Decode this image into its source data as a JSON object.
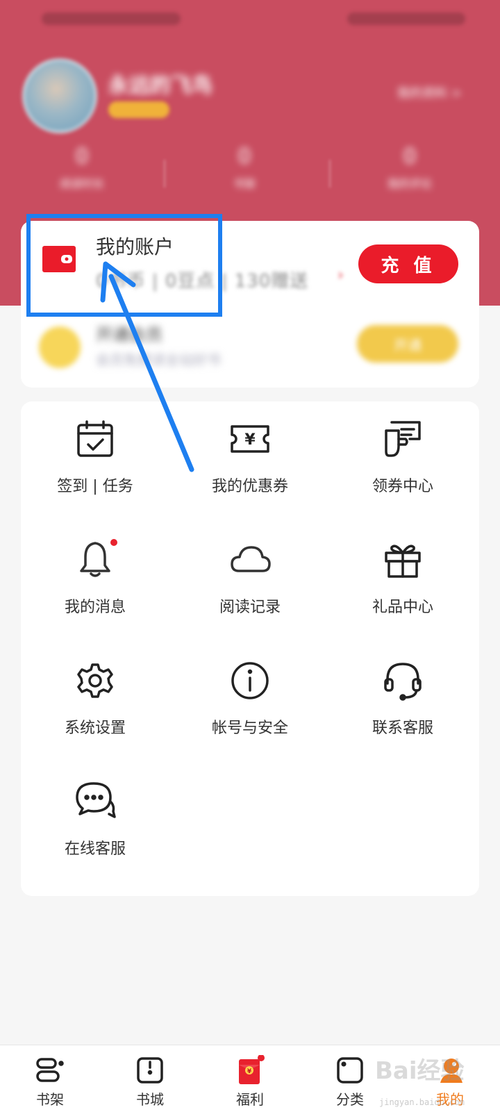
{
  "header": {
    "user_name": "永远的飞鸟",
    "profile_link": "我的资料 >",
    "stats": [
      {
        "value": "0",
        "label": "阅读时长"
      },
      {
        "value": "0",
        "label": "书架"
      },
      {
        "value": "0",
        "label": "我的评论"
      }
    ]
  },
  "account": {
    "title": "我的账户",
    "balance_text": "0书币 | 0豆点 | 130赠送",
    "recharge_label": "充 值",
    "vip_title": "开通会员",
    "vip_subtitle": "会员免费读全站好书",
    "vip_button": "开通"
  },
  "menu": {
    "items": [
      {
        "label": "签到 | 任务",
        "icon": "calendar-check-icon"
      },
      {
        "label": "我的优惠券",
        "icon": "yuan-ticket-icon"
      },
      {
        "label": "领券中心",
        "icon": "hand-coupon-icon"
      },
      {
        "label": "我的消息",
        "icon": "bell-icon"
      },
      {
        "label": "阅读记录",
        "icon": "cloud-icon"
      },
      {
        "label": "礼品中心",
        "icon": "gift-icon"
      },
      {
        "label": "系统设置",
        "icon": "gear-icon"
      },
      {
        "label": "帐号与安全",
        "icon": "info-icon"
      },
      {
        "label": "联系客服",
        "icon": "headset-icon"
      },
      {
        "label": "在线客服",
        "icon": "chat-bubbles-icon"
      }
    ]
  },
  "bottom_nav": {
    "items": [
      {
        "label": "书架",
        "icon": "bookshelf-icon"
      },
      {
        "label": "书城",
        "icon": "bookstore-icon"
      },
      {
        "label": "福利",
        "icon": "red-envelope-icon"
      },
      {
        "label": "分类",
        "icon": "category-icon"
      },
      {
        "label": "我的",
        "icon": "profile-icon"
      }
    ],
    "active_index": 4
  },
  "watermark": {
    "text": "Bai经验",
    "url": "jingyan.baidu.com"
  },
  "colors": {
    "header_bg": "#c94d60",
    "accent_red": "#ea1c2a",
    "highlight_blue": "#1e7ff0",
    "active_nav": "#f07c1e"
  }
}
